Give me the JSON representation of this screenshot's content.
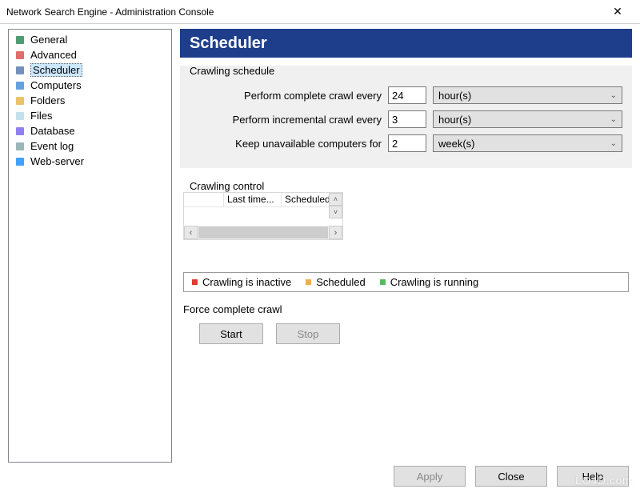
{
  "window": {
    "title": "Network Search Engine - Administration Console",
    "close_glyph": "✕"
  },
  "sidebar": {
    "items": [
      {
        "label": "General",
        "icon": "general-icon",
        "color": "#2e8b57"
      },
      {
        "label": "Advanced",
        "icon": "advanced-icon",
        "color": "#d9534f"
      },
      {
        "label": "Scheduler",
        "icon": "scheduler-icon",
        "color": "#5b7db1",
        "selected": true
      },
      {
        "label": "Computers",
        "icon": "computers-icon",
        "color": "#4a90d9"
      },
      {
        "label": "Folders",
        "icon": "folders-icon",
        "color": "#e6b84f"
      },
      {
        "label": "Files",
        "icon": "files-icon",
        "color": "#b7dce8"
      },
      {
        "label": "Database",
        "icon": "database-icon",
        "color": "#7b68ee"
      },
      {
        "label": "Event log",
        "icon": "eventlog-icon",
        "color": "#8aa"
      },
      {
        "label": "Web-server",
        "icon": "webserver-icon",
        "color": "#1e90ff"
      }
    ]
  },
  "content": {
    "header": "Scheduler",
    "schedule": {
      "group_title": "Crawling schedule",
      "rows": [
        {
          "label": "Perform complete crawl every",
          "value": "24",
          "unit": "hour(s)"
        },
        {
          "label": "Perform incremental crawl every",
          "value": "3",
          "unit": "hour(s)"
        },
        {
          "label": "Keep unavailable computers for",
          "value": "2",
          "unit": "week(s)"
        }
      ]
    },
    "control": {
      "group_title": "Crawling control",
      "columns": [
        "Last time...",
        "Scheduled"
      ]
    },
    "legend": {
      "items": [
        {
          "label": "Crawling is inactive",
          "color": "#e03c31"
        },
        {
          "label": "Scheduled",
          "color": "#f0ad4e"
        },
        {
          "label": "Crawling is running",
          "color": "#5cb85c"
        }
      ]
    },
    "force": {
      "title": "Force complete crawl",
      "start": "Start",
      "stop": "Stop"
    }
  },
  "buttons": {
    "apply": "Apply",
    "close": "Close",
    "help": "Help"
  },
  "watermark": "LO4D.com"
}
